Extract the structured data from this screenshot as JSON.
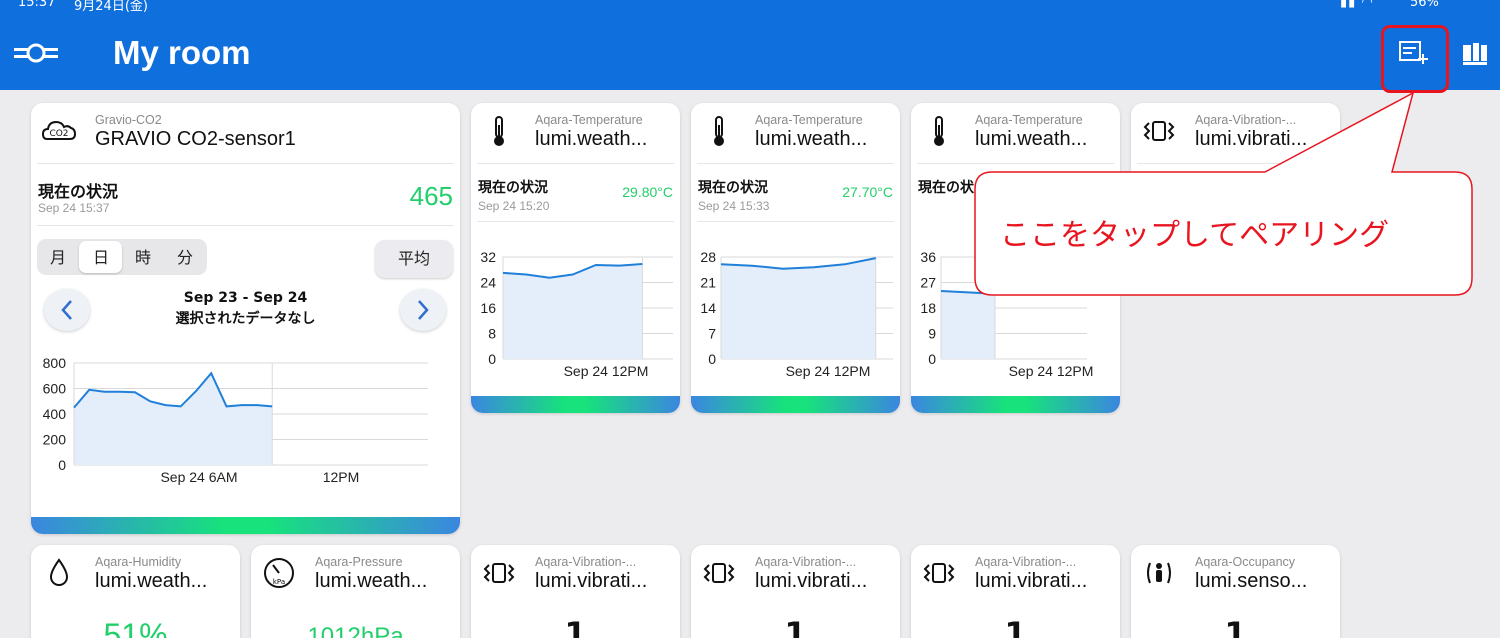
{
  "statusbar": {
    "time": "15:37",
    "date": "9月24日(金)",
    "battery": "56%"
  },
  "header": {
    "title": "My room"
  },
  "co2": {
    "type": "Gravio-CO2",
    "name": "GRAVIO CO2-sensor1",
    "status_label": "現在の状況",
    "date": "Sep 24 15:37",
    "value": "465",
    "segments": [
      "月",
      "日",
      "時",
      "分"
    ],
    "avg_label": "平均",
    "range": "Sep 23 - Sep 24",
    "no_data": "選択されたデータなし"
  },
  "temp1": {
    "type": "Aqara-Temperature",
    "name": "lumi.weath...",
    "status_label": "現在の状況",
    "date": "Sep 24 15:20",
    "value": "29.80°C"
  },
  "temp2": {
    "type": "Aqara-Temperature",
    "name": "lumi.weath...",
    "status_label": "現在の状況",
    "date": "Sep 24 15:33",
    "value": "27.70°C"
  },
  "temp3": {
    "type": "Aqara-Temperature",
    "name": "lumi.weath...",
    "status_label": "現在の状"
  },
  "vib_top": {
    "type": "Aqara-Vibration-...",
    "name": "lumi.vibrati..."
  },
  "bottom": [
    {
      "type": "Aqara-Humidity",
      "name": "lumi.weath...",
      "value": "51%"
    },
    {
      "type": "Aqara-Pressure",
      "name": "lumi.weath...",
      "value": "1012hPa"
    },
    {
      "type": "Aqara-Vibration-...",
      "name": "lumi.vibrati...",
      "value": "1"
    },
    {
      "type": "Aqara-Vibration-...",
      "name": "lumi.vibrati...",
      "value": "1"
    },
    {
      "type": "Aqara-Vibration-...",
      "name": "lumi.vibrati...",
      "value": "1"
    },
    {
      "type": "Aqara-Occupancy",
      "name": "lumi.senso...",
      "value": "1"
    }
  ],
  "callout": {
    "text": "ここをタップしてペアリング"
  },
  "colors": {
    "header": "#0f6fdc",
    "value_green": "#22cf6a",
    "callout_red": "#e8151f"
  },
  "chart_data": [
    {
      "type": "area",
      "series": [
        {
          "values": [
            450,
            590,
            575,
            575,
            570,
            500,
            470,
            460,
            580,
            720,
            460,
            470,
            470,
            460
          ]
        }
      ],
      "x": [
        "Sep 24 6AM",
        "12PM"
      ],
      "ylim": [
        0,
        800
      ],
      "yticks": [
        "800",
        "600",
        "400",
        "200",
        "0"
      ]
    },
    {
      "type": "area",
      "series": [
        {
          "values": [
            27,
            26.5,
            25.5,
            26.5,
            29.5,
            29.3,
            29.8
          ]
        }
      ],
      "x": [
        "Sep 24 12PM"
      ],
      "ylim": [
        0,
        32
      ],
      "yticks": [
        "32",
        "24",
        "16",
        "8",
        "0"
      ]
    },
    {
      "type": "area",
      "series": [
        {
          "values": [
            26,
            25.6,
            24.8,
            25.2,
            26,
            27.7
          ]
        }
      ],
      "x": [
        "Sep 24 12PM"
      ],
      "ylim": [
        0,
        28
      ],
      "yticks": [
        "28",
        "21",
        "14",
        "7",
        "0"
      ]
    },
    {
      "type": "area",
      "series": [
        {
          "values": [
            24,
            23.5,
            23
          ]
        }
      ],
      "x": [
        "Sep 24 12PM"
      ],
      "ylim": [
        0,
        36
      ],
      "yticks": [
        "36",
        "27",
        "18",
        "9",
        "0"
      ]
    }
  ]
}
